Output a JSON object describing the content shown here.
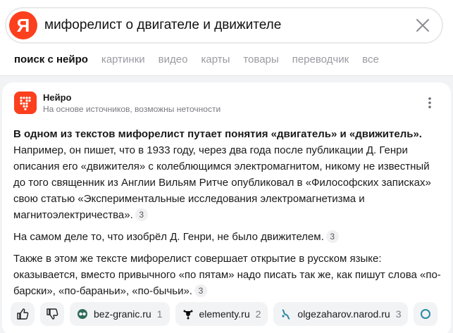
{
  "search": {
    "logo_letter": "Я",
    "query": "мифорелист о двигателе и движителе"
  },
  "tabs": [
    {
      "label": "поиск с нейро",
      "active": true
    },
    {
      "label": "картинки"
    },
    {
      "label": "видео"
    },
    {
      "label": "карты"
    },
    {
      "label": "товары"
    },
    {
      "label": "переводчик"
    },
    {
      "label": "все"
    }
  ],
  "card": {
    "author": "Нейро",
    "subtitle": "На основе источников, возможны неточности",
    "paragraphs": [
      {
        "bold": "В одном из текстов мифорелист путает понятия «двигатель» и «движитель».",
        "text": " Например, он пишет, что в 1933 году, через два года после публикации Д. Генри описания его «движителя» с колеблющимся электромагнитом, никому не известный до того священник из Англии Вильям Ритче опубликовал в «Философских записках» свою статью «Экспериментальные исследования электромагнетизма и магнитоэлектричества».",
        "ref": "3"
      },
      {
        "bold": "",
        "text": "На самом деле то, что изобрёл Д. Генри, не было движителем.",
        "ref": "3"
      },
      {
        "bold": "",
        "text": "Также в этом же тексте мифорелист совершает открытие в русском языке: оказывается, вместо привычного «по пятам» надо писать так же, как пишут слова «по-барски», «по-бараньи», «по-бычьи».",
        "ref": "3"
      }
    ],
    "sources": [
      {
        "name": "bez-granic.ru",
        "count": "1"
      },
      {
        "name": "elementy.ru",
        "count": "2"
      },
      {
        "name": "olgezaharov.narod.ru",
        "count": "3"
      }
    ]
  },
  "colors": {
    "accent": "#fc3f1d",
    "bg": "#f2f3f5"
  }
}
